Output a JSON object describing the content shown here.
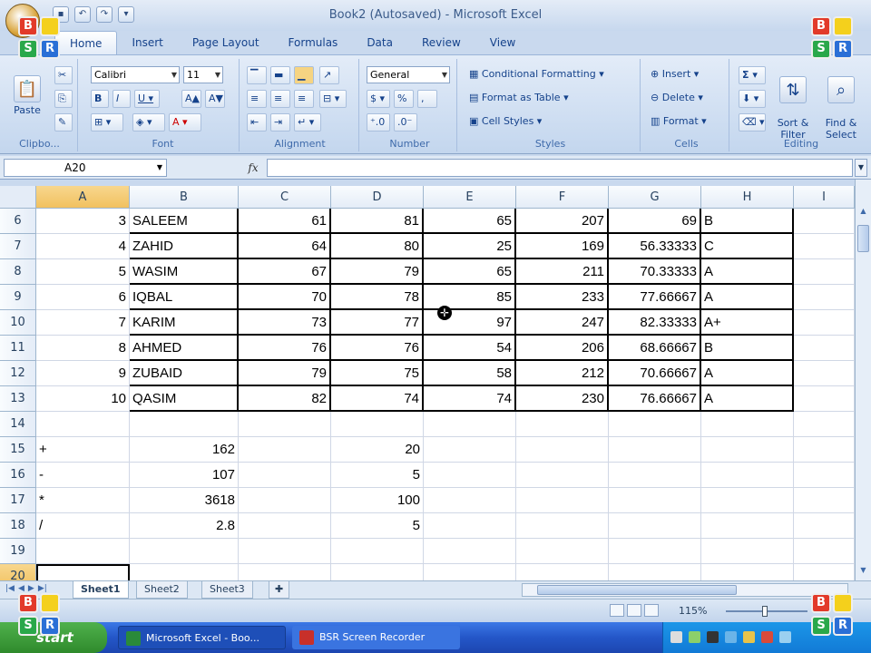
{
  "window": {
    "title": "Book2 (Autosaved) - Microsoft Excel"
  },
  "ribbon": {
    "tabs": [
      "Home",
      "Insert",
      "Page Layout",
      "Formulas",
      "Data",
      "Review",
      "View"
    ],
    "active_tab": "Home",
    "clipboard": {
      "paste": "Paste",
      "label": "Clipbo..."
    },
    "font": {
      "name": "Calibri",
      "size": "11",
      "label": "Font"
    },
    "alignment": {
      "label": "Alignment"
    },
    "number": {
      "format": "General",
      "currency": "$",
      "percent": "%",
      "comma": ",",
      "label": "Number"
    },
    "styles": {
      "conditional": "Conditional Formatting",
      "format_table": "Format as Table",
      "cell_styles": "Cell Styles",
      "label": "Styles"
    },
    "cells": {
      "insert": "Insert",
      "delete": "Delete",
      "format": "Format",
      "label": "Cells"
    },
    "editing": {
      "sigma": "Σ",
      "sort": "Sort &\nFilter",
      "find": "Find &\nSelect",
      "label": "Editing"
    }
  },
  "formula_bar": {
    "name_box": "A20",
    "fx": "fx",
    "value": ""
  },
  "columns": [
    "A",
    "B",
    "C",
    "D",
    "E",
    "F",
    "G",
    "H",
    "I"
  ],
  "selected_column": "A",
  "rows": [
    {
      "n": "6",
      "cells": [
        "3",
        "SALEEM",
        "61",
        "81",
        "65",
        "207",
        "69",
        "B"
      ]
    },
    {
      "n": "7",
      "cells": [
        "4",
        "ZAHID",
        "64",
        "80",
        "25",
        "169",
        "56.33333",
        "C"
      ]
    },
    {
      "n": "8",
      "cells": [
        "5",
        "WASIM",
        "67",
        "79",
        "65",
        "211",
        "70.33333",
        "A"
      ]
    },
    {
      "n": "9",
      "cells": [
        "6",
        "IQBAL",
        "70",
        "78",
        "85",
        "233",
        "77.66667",
        "A"
      ]
    },
    {
      "n": "10",
      "cells": [
        "7",
        "KARIM",
        "73",
        "77",
        "97",
        "247",
        "82.33333",
        "A+"
      ]
    },
    {
      "n": "11",
      "cells": [
        "8",
        "AHMED",
        "76",
        "76",
        "54",
        "206",
        "68.66667",
        "B"
      ]
    },
    {
      "n": "12",
      "cells": [
        "9",
        "ZUBAID",
        "79",
        "75",
        "58",
        "212",
        "70.66667",
        "A"
      ]
    },
    {
      "n": "13",
      "cells": [
        "10",
        "QASIM",
        "82",
        "74",
        "74",
        "230",
        "76.66667",
        "A"
      ]
    },
    {
      "n": "14",
      "cells": [
        "",
        "",
        "",
        "",
        "",
        "",
        "",
        ""
      ]
    },
    {
      "n": "15",
      "cells": [
        "+",
        "162",
        "",
        "20",
        "",
        "",
        "",
        ""
      ]
    },
    {
      "n": "16",
      "cells": [
        "-",
        "107",
        "",
        "5",
        "",
        "",
        "",
        ""
      ]
    },
    {
      "n": "17",
      "cells": [
        "*",
        "3618",
        "",
        "100",
        "",
        "",
        "",
        ""
      ]
    },
    {
      "n": "18",
      "cells": [
        "/",
        "2.8",
        "",
        "5",
        "",
        "",
        "",
        ""
      ]
    },
    {
      "n": "19",
      "cells": [
        "",
        "",
        "",
        "",
        "",
        "",
        "",
        ""
      ]
    },
    {
      "n": "20",
      "cells": [
        "",
        "",
        "",
        "",
        "",
        "",
        "",
        ""
      ]
    }
  ],
  "selected_row": "20",
  "sheets": [
    "Sheet1",
    "Sheet2",
    "Sheet3"
  ],
  "active_sheet": "Sheet1",
  "status": {
    "zoom": "115%"
  },
  "taskbar": {
    "start": "start",
    "items": [
      "Microsoft Excel - Boo...",
      "BSR Screen Recorder"
    ]
  },
  "logo": {
    "letters": [
      "B",
      "S",
      "S",
      "R"
    ]
  },
  "colors": {
    "header_selected": "#f1c15f",
    "ribbon": "#c3d6ee",
    "taskbar": "#2456c8"
  }
}
